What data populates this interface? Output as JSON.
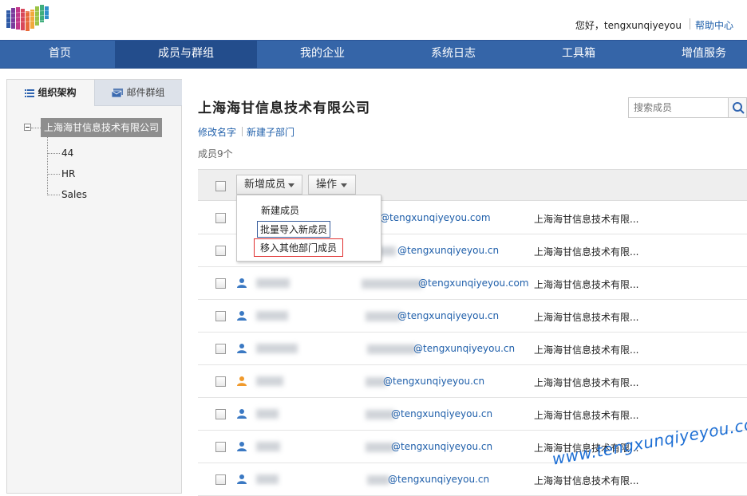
{
  "header": {
    "greeting": "您好，tengxunqiyeyou",
    "help_label": "帮助中心"
  },
  "nav": {
    "items": [
      "首页",
      "成员与群组",
      "我的企业",
      "系统日志",
      "工具箱",
      "增值服务"
    ],
    "active_index": 1
  },
  "sidebar": {
    "tabs": {
      "org": "组织架构",
      "mail_group": "邮件群组"
    },
    "tree": {
      "root": "上海海甘信息技术有限公司",
      "children": [
        "44",
        "HR",
        "Sales"
      ]
    }
  },
  "main": {
    "title": "上海海甘信息技术有限公司",
    "links": {
      "rename": "修改名字",
      "new_sub": "新建子部门"
    },
    "count": "成员9个",
    "search": {
      "placeholder": "搜索成员"
    },
    "toolbar": {
      "add_member": "新增成员",
      "operations": "操作"
    },
    "dropdown": {
      "new_member": "新建成员",
      "batch_import": "批量导入新成员",
      "move_members": "移入其他部门成员"
    },
    "rows": [
      {
        "email": "@tengxunqiyeyou.com",
        "dept": "上海海甘信息技术有限...",
        "icon_color": "#3b79c3"
      },
      {
        "email": "@tengxunqiyeyou.cn",
        "dept": "上海海甘信息技术有限...",
        "icon_color": "#3b79c3"
      },
      {
        "email": "@tengxunqiyeyou.com",
        "dept": "上海海甘信息技术有限...",
        "icon_color": "#3b79c3"
      },
      {
        "email": "@tengxunqiyeyou.cn",
        "dept": "上海海甘信息技术有限...",
        "icon_color": "#3b79c3"
      },
      {
        "email": "@tengxunqiyeyou.cn",
        "dept": "上海海甘信息技术有限...",
        "icon_color": "#3b79c3"
      },
      {
        "email": "@tengxunqiyeyou.cn",
        "dept": "上海海甘信息技术有限...",
        "icon_color": "#f09a2c"
      },
      {
        "email": "@tengxunqiyeyou.cn",
        "dept": "上海海甘信息技术有限...",
        "icon_color": "#3b79c3"
      },
      {
        "email": "@tengxunqiyeyou.cn",
        "dept": "上海海甘信息技术有限...",
        "icon_color": "#3b79c3"
      },
      {
        "email": "@tengxunqiyeyou.cn",
        "dept": "上海海甘信息技术有限...",
        "icon_color": "#3b79c3"
      }
    ]
  },
  "watermark": "www.tengxunqiyeyou.com",
  "colors": {
    "nav_bg": "#3565a8",
    "nav_active": "#234d8c",
    "link": "#1f5faa"
  }
}
